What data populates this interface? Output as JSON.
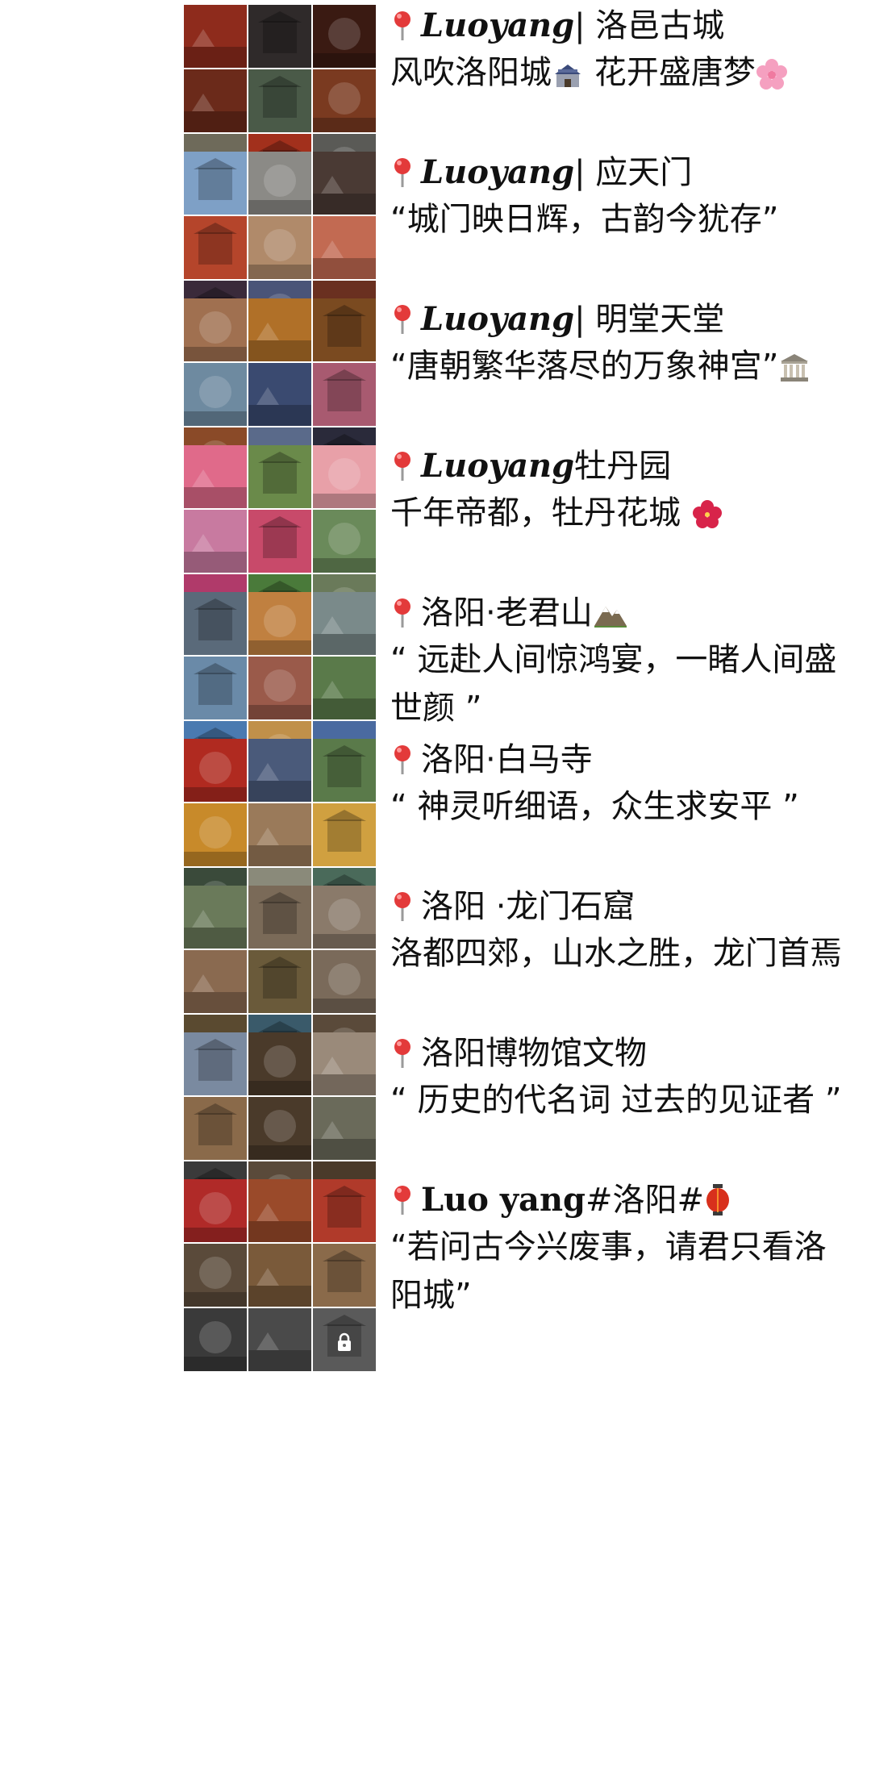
{
  "posts": [
    {
      "title_latin": "Luoyang",
      "title_rest": " | 洛邑古城",
      "caption": "风吹洛阳城",
      "caption_tail": " 花开盛唐梦",
      "emoji_mid": "castle",
      "emoji_end": "cherry-blossom",
      "tiles": [
        "#8e2b1c",
        "#2f2a2a",
        "#3a1a12",
        "#6b2a1a",
        "#4a5a48",
        "#7a3a20",
        "#6e6a5a",
        "#a2301c",
        "#5a5a56"
      ],
      "latin_style": "italic"
    },
    {
      "title_latin": "Luoyang",
      "title_rest": " | 应天门",
      "caption": "“城门映日辉，古韵今犹存”",
      "caption_tail": "",
      "tiles": [
        "#7ea0c6",
        "#8b8a86",
        "#4a3a34",
        "#b5452b",
        "#b08a6a",
        "#c26a52",
        "#3a2a3a",
        "#4a5478",
        "#6a3020"
      ],
      "latin_style": "italic"
    },
    {
      "title_latin": "Luoyang",
      "title_rest": " | 明堂天堂",
      "caption": "“唐朝繁华落尽的万象神宫”",
      "caption_tail": "",
      "emoji_end": "classical-building",
      "tiles": [
        "#a07050",
        "#b07028",
        "#7a4a20",
        "#6e8aa0",
        "#3a4a70",
        "#a85a70",
        "#8a4a28",
        "#5a6a8a",
        "#2a2a3a"
      ],
      "latin_style": "italic"
    },
    {
      "title_latin": "Luoyang",
      "title_rest": "牡丹园",
      "caption": "千年帝都，牡丹花城 ",
      "caption_tail": "",
      "emoji_end": "hibiscus",
      "tiles": [
        "#e06a8a",
        "#6a8a4a",
        "#e8a0a8",
        "#c87aa0",
        "#c84a6a",
        "#6a8a5a",
        "#b03a6a",
        "#4a7a3a",
        "#6a7a5a"
      ],
      "latin_style": "italic"
    },
    {
      "title_latin": "",
      "title_rest": "洛阳·老君山",
      "caption": "“ 远赴人间惊鸿宴，一睹人间盛世颜 ”",
      "caption_tail": "",
      "emoji_title": "mountain",
      "tiles": [
        "#5a6a7a",
        "#c08040",
        "#7a8a8a",
        "#6a8aa8",
        "#9a5a4a",
        "#5a7a4a",
        "#4a7ab0",
        "#c0904a",
        "#4a6aa0"
      ],
      "latin_style": "none"
    },
    {
      "title_latin": "",
      "title_rest": "洛阳·白马寺",
      "caption": "“ 神灵听细语，众生求安平 ”",
      "caption_tail": "",
      "tiles": [
        "#b02a20",
        "#4a5a7a",
        "#5a7a4a",
        "#c88a2a",
        "#9a7a5a",
        "#d0a040",
        "#3a4a3a",
        "#8a8a7a",
        "#4a6a5a"
      ],
      "latin_style": "none"
    },
    {
      "title_latin": "",
      "title_rest": "洛阳 ·龙门石窟",
      "caption": "洛都四郊，山水之胜，龙门首焉",
      "caption_tail": "",
      "tiles": [
        "#6a7a5a",
        "#7a6a58",
        "#8a7a6a",
        "#8a6a50",
        "#6a5a3a",
        "#7a6a5a",
        "#5a4a30",
        "#3a5a6a",
        "#5a4a3a"
      ],
      "latin_style": "none"
    },
    {
      "title_latin": "",
      "title_rest": "洛阳博物馆文物",
      "caption": "“ 历史的代名词 过去的见证者 ”",
      "caption_tail": "",
      "tiles": [
        "#7a8aa0",
        "#4a3a2a",
        "#9a8a7a",
        "#8a6a4a",
        "#4a3a2a",
        "#6a6a5a",
        "#3a3a3a",
        "#5a4a3a",
        "#4a3a2a"
      ],
      "latin_style": "none"
    },
    {
      "title_latin": "Luo yang",
      "title_rest": "#洛阳# ",
      "caption": "“若问古今兴废事，请君只看洛阳城”",
      "caption_tail": "",
      "emoji_title": "red-lantern",
      "tiles": [
        "#b02a28",
        "#9a4a2a",
        "#b03a2a",
        "#5a4a3a",
        "#7a5a3a",
        "#8a6a4a",
        "#3a3a3a",
        "#4a4a4a",
        "#5a5a5a"
      ],
      "latin_style": "plain"
    }
  ]
}
